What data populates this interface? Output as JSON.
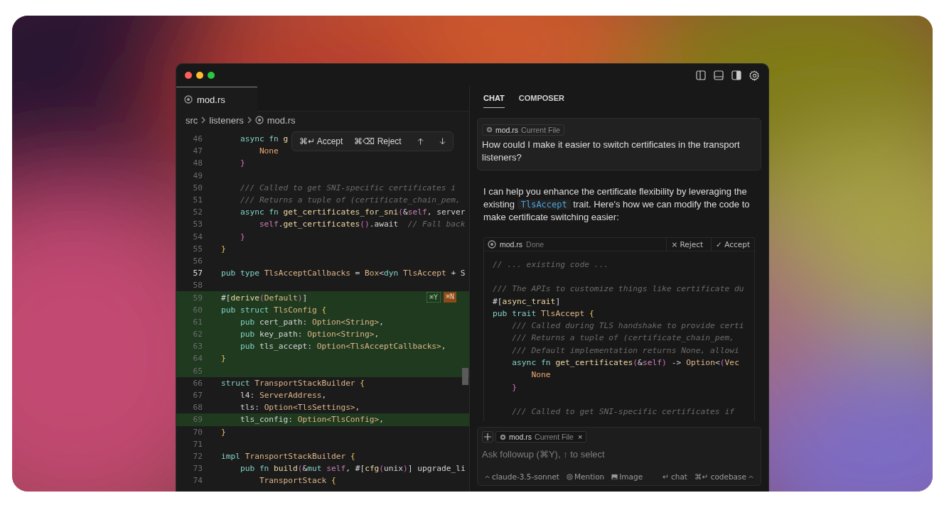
{
  "editor": {
    "tabs": [
      {
        "label": "mod.rs",
        "selected": true
      }
    ],
    "breadcrumb": [
      "src",
      "listeners",
      "mod.rs"
    ],
    "diff_toolbar": {
      "accept": "⌘↵ Accept",
      "reject": "⌘⌫ Reject"
    },
    "lines": [
      {
        "number": "46",
        "kind": "plain",
        "tokens": [
          {
            "text": "    async fn ",
            "kind": "kw"
          },
          {
            "text": "g",
            "kind": "fn"
          }
        ]
      },
      {
        "number": "47",
        "kind": "plain",
        "tokens": [
          {
            "text": "        None",
            "kind": "val"
          }
        ]
      },
      {
        "number": "48",
        "kind": "plain",
        "tokens": [
          {
            "text": "    }",
            "kind": "paren"
          }
        ]
      },
      {
        "number": "49",
        "kind": "plain"
      },
      {
        "number": "50",
        "kind": "plain",
        "tokens": [
          {
            "text": "    /// Called to get SNI-specific certificates i",
            "kind": "com"
          }
        ]
      },
      {
        "number": "51",
        "kind": "plain",
        "tokens": [
          {
            "text": "    /// Returns a tuple of (certificate_chain_pem,",
            "kind": "com"
          }
        ]
      },
      {
        "number": "52",
        "kind": "plain",
        "tokens": [
          {
            "text": "    async fn ",
            "kind": "kw"
          },
          {
            "text": "get_certificates_for_sni",
            "kind": "fn"
          },
          {
            "text": "(",
            "kind": "paren"
          },
          {
            "text": "&",
            "kind": "id"
          },
          {
            "text": "self",
            "kind": "self"
          },
          {
            "text": ", server",
            "kind": "id"
          }
        ]
      },
      {
        "number": "53",
        "kind": "plain",
        "tokens": [
          {
            "text": "        self",
            "kind": "self"
          },
          {
            "text": ".",
            "kind": "id"
          },
          {
            "text": "get_certificates",
            "kind": "fn"
          },
          {
            "text": "()",
            "kind": "paren"
          },
          {
            "text": ".await",
            "kind": "id"
          },
          {
            "text": "  // Fall back",
            "kind": "com"
          }
        ]
      },
      {
        "number": "54",
        "kind": "plain",
        "tokens": [
          {
            "text": "    }",
            "kind": "paren"
          }
        ]
      },
      {
        "number": "55",
        "kind": "plain",
        "tokens": [
          {
            "text": "}",
            "kind": "brace"
          }
        ]
      },
      {
        "number": "56",
        "kind": "plain"
      },
      {
        "number": "57",
        "kind": "current",
        "tokens": [
          {
            "text": "pub type ",
            "kind": "kw"
          },
          {
            "text": "TlsAcceptCallbacks",
            "kind": "type"
          },
          {
            "text": " = ",
            "kind": "id"
          },
          {
            "text": "Box",
            "kind": "type"
          },
          {
            "text": "<",
            "kind": "id"
          },
          {
            "text": "dyn ",
            "kind": "kw"
          },
          {
            "text": "TlsAccept",
            "kind": "type"
          },
          {
            "text": " + S",
            "kind": "id"
          }
        ]
      },
      {
        "number": "58",
        "kind": "plain"
      },
      {
        "number": "59",
        "kind": "added",
        "tokens": [
          {
            "text": "#[",
            "kind": "id"
          },
          {
            "text": "derive",
            "kind": "fn"
          },
          {
            "text": "(",
            "kind": "paren"
          },
          {
            "text": "Default",
            "kind": "type"
          },
          {
            "text": ")",
            "kind": "paren"
          },
          {
            "text": "]",
            "kind": "id"
          }
        ],
        "badges": [
          {
            "text": "⌘Y",
            "kind": "accept"
          },
          {
            "text": "⌘N",
            "kind": "reject"
          }
        ]
      },
      {
        "number": "60",
        "kind": "added",
        "tokens": [
          {
            "text": "pub struct ",
            "kind": "kw"
          },
          {
            "text": "TlsConfig",
            "kind": "type"
          },
          {
            "text": " {",
            "kind": "brace"
          }
        ]
      },
      {
        "number": "61",
        "kind": "added",
        "tokens": [
          {
            "text": "    pub ",
            "kind": "kw"
          },
          {
            "text": "cert_path: ",
            "kind": "id"
          },
          {
            "text": "Option<String>",
            "kind": "type"
          },
          {
            "text": ",",
            "kind": "id"
          }
        ]
      },
      {
        "number": "62",
        "kind": "added",
        "tokens": [
          {
            "text": "    pub ",
            "kind": "kw"
          },
          {
            "text": "key_path: ",
            "kind": "id"
          },
          {
            "text": "Option<String>",
            "kind": "type"
          },
          {
            "text": ",",
            "kind": "id"
          }
        ]
      },
      {
        "number": "63",
        "kind": "added",
        "tokens": [
          {
            "text": "    pub ",
            "kind": "kw"
          },
          {
            "text": "tls_accept: ",
            "kind": "id"
          },
          {
            "text": "Option<TlsAcceptCallbacks>",
            "kind": "type"
          },
          {
            "text": ",",
            "kind": "id"
          }
        ]
      },
      {
        "number": "64",
        "kind": "added",
        "tokens": [
          {
            "text": "}",
            "kind": "brace"
          }
        ]
      },
      {
        "number": "65",
        "kind": "added"
      },
      {
        "number": "66",
        "kind": "plain",
        "tokens": [
          {
            "text": "struct ",
            "kind": "kw"
          },
          {
            "text": "TransportStackBuilder",
            "kind": "type"
          },
          {
            "text": " {",
            "kind": "brace"
          }
        ]
      },
      {
        "number": "67",
        "kind": "plain",
        "tokens": [
          {
            "text": "    l4: ",
            "kind": "id"
          },
          {
            "text": "ServerAddress",
            "kind": "type"
          },
          {
            "text": ",",
            "kind": "id"
          }
        ]
      },
      {
        "number": "68",
        "kind": "plain",
        "tokens": [
          {
            "text": "    tls: ",
            "kind": "id"
          },
          {
            "text": "Option<TlsSettings>",
            "kind": "type"
          },
          {
            "text": ",",
            "kind": "id"
          }
        ]
      },
      {
        "number": "69",
        "kind": "added",
        "tokens": [
          {
            "text": "    tls_config: ",
            "kind": "id"
          },
          {
            "text": "Option<TlsConfig>",
            "kind": "type"
          },
          {
            "text": ",",
            "kind": "id"
          }
        ]
      },
      {
        "number": "70",
        "kind": "plain",
        "tokens": [
          {
            "text": "}",
            "kind": "brace"
          }
        ]
      },
      {
        "number": "71",
        "kind": "plain"
      },
      {
        "number": "72",
        "kind": "plain",
        "tokens": [
          {
            "text": "impl ",
            "kind": "kw"
          },
          {
            "text": "TransportStackBuilder",
            "kind": "type"
          },
          {
            "text": " {",
            "kind": "brace"
          }
        ]
      },
      {
        "number": "73",
        "kind": "plain",
        "tokens": [
          {
            "text": "    pub fn ",
            "kind": "kw"
          },
          {
            "text": "build",
            "kind": "fn"
          },
          {
            "text": "(",
            "kind": "paren"
          },
          {
            "text": "&",
            "kind": "id"
          },
          {
            "text": "mut ",
            "kind": "kw"
          },
          {
            "text": "self",
            "kind": "self"
          },
          {
            "text": ", #[",
            "kind": "id"
          },
          {
            "text": "cfg",
            "kind": "fn"
          },
          {
            "text": "(",
            "kind": "paren"
          },
          {
            "text": "unix",
            "kind": "id"
          },
          {
            "text": ")",
            "kind": "paren"
          },
          {
            "text": "] upgrade_li",
            "kind": "id"
          }
        ]
      },
      {
        "number": "74",
        "kind": "plain",
        "tokens": [
          {
            "text": "        TransportStack",
            "kind": "type"
          },
          {
            "text": " {",
            "kind": "brace"
          }
        ]
      }
    ]
  },
  "chat_panel": {
    "tabs": [
      {
        "label": "CHAT",
        "selected": true
      },
      {
        "label": "COMPOSER",
        "selected": false
      }
    ],
    "user_message": {
      "chip": {
        "file": "mod.rs",
        "note": "Current File"
      },
      "text": "How could I make it easier to switch certificates in the transport listeners?"
    },
    "assistant_message": [
      {
        "text": "I can help you enhance the certificate flexibility by leveraging the existing ",
        "kind": "text"
      },
      {
        "text": "TlsAccept",
        "kind": "code"
      },
      {
        "text": " trait. Here's how we can modify the code to make certificate switching easier:",
        "kind": "text"
      }
    ],
    "code_block": {
      "file": "mod.rs",
      "status": "Done",
      "reject": "× Reject",
      "accept": "✓ Accept",
      "lines": [
        {
          "kind": "code",
          "tokens": [
            {
              "text": "// ... existing code ...",
              "kind": "com"
            }
          ]
        },
        {
          "kind": "blank"
        },
        {
          "kind": "code",
          "tokens": [
            {
              "text": "/// The APIs to customize things like certificate du",
              "kind": "com"
            }
          ]
        },
        {
          "kind": "code",
          "tokens": [
            {
              "text": "#[",
              "kind": "id"
            },
            {
              "text": "async_trait",
              "kind": "fn"
            },
            {
              "text": "]",
              "kind": "id"
            }
          ]
        },
        {
          "kind": "code",
          "tokens": [
            {
              "text": "pub trait ",
              "kind": "kw"
            },
            {
              "text": "TlsAccept",
              "kind": "type"
            },
            {
              "text": " {",
              "kind": "brace"
            }
          ]
        },
        {
          "kind": "code",
          "tokens": [
            {
              "text": "    /// Called during TLS handshake to provide certi",
              "kind": "com"
            }
          ]
        },
        {
          "kind": "code",
          "tokens": [
            {
              "text": "    /// Returns a tuple of (certificate_chain_pem,",
              "kind": "com"
            }
          ]
        },
        {
          "kind": "code",
          "tokens": [
            {
              "text": "    /// Default implementation returns None, allowi",
              "kind": "com"
            }
          ]
        },
        {
          "kind": "code",
          "tokens": [
            {
              "text": "    async fn ",
              "kind": "kw"
            },
            {
              "text": "get_certificates",
              "kind": "fn"
            },
            {
              "text": "(",
              "kind": "paren"
            },
            {
              "text": "&",
              "kind": "id"
            },
            {
              "text": "self",
              "kind": "self"
            },
            {
              "text": ")",
              "kind": "paren"
            },
            {
              "text": " -> ",
              "kind": "id"
            },
            {
              "text": "Option",
              "kind": "type"
            },
            {
              "text": "<",
              "kind": "id"
            },
            {
              "text": "(",
              "kind": "paren"
            },
            {
              "text": "Vec",
              "kind": "type"
            }
          ]
        },
        {
          "kind": "code",
          "tokens": [
            {
              "text": "        None",
              "kind": "val"
            }
          ]
        },
        {
          "kind": "code",
          "tokens": [
            {
              "text": "    }",
              "kind": "paren"
            }
          ]
        },
        {
          "kind": "blank"
        },
        {
          "kind": "code",
          "tokens": [
            {
              "text": "    /// Called to get SNI-specific certificates if",
              "kind": "com"
            }
          ]
        }
      ]
    },
    "input": {
      "chip": {
        "file": "mod.rs",
        "note": "Current File",
        "remove": "×"
      },
      "placeholder": "Ask followup (⌘Y), ↑ to select",
      "model": "claude-3.5-sonnet",
      "mention": "Mention",
      "image": "Image",
      "chat": "↵ chat",
      "codebase": "⌘↵ codebase"
    }
  }
}
